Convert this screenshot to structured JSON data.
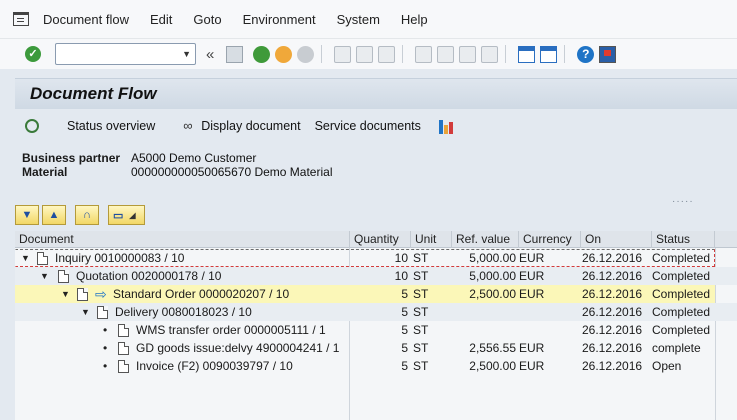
{
  "menu": {
    "items": [
      "Document flow",
      "Edit",
      "Goto",
      "Environment",
      "System",
      "Help"
    ]
  },
  "system_toolbar": {
    "command_field_value": "",
    "icons": [
      "enter-icon",
      "save-icon",
      "back-icon",
      "exit-icon",
      "cancel-icon",
      "print-icon",
      "find-icon",
      "find-next-icon",
      "first-page-icon",
      "previous-page-icon",
      "next-page-icon",
      "last-page-icon",
      "create-session-icon",
      "shortcut-icon",
      "help-icon",
      "customize-layout-icon"
    ],
    "help_glyph": "?"
  },
  "title": "Document Flow",
  "app_toolbar": {
    "status_overview": "Status overview",
    "display_document": "Display document",
    "service_documents": "Service documents"
  },
  "header_info": {
    "business_partner_label": "Business partner",
    "business_partner_value": "A5000 Demo Customer",
    "material_label": "Material",
    "material_value": "000000000050065670 Demo Material"
  },
  "grid_toolbar": {
    "icons": [
      "expand-all-icon",
      "collapse-all-icon",
      "find-icon",
      "print-icon"
    ]
  },
  "table": {
    "columns": [
      "Document",
      "Quantity",
      "Unit",
      "Ref. value",
      "Currency",
      "On",
      "Status"
    ],
    "rows": [
      {
        "document": "Inquiry 0010000083 / 10",
        "quantity": "10",
        "unit": "ST",
        "ref_value": "5,000.00",
        "currency": "EUR",
        "on": "26.12.2016",
        "status": "Completed"
      },
      {
        "document": "Quotation 0020000178 / 10",
        "quantity": "10",
        "unit": "ST",
        "ref_value": "5,000.00",
        "currency": "EUR",
        "on": "26.12.2016",
        "status": "Completed"
      },
      {
        "document": "Standard Order 0000020207 / 10",
        "quantity": "5",
        "unit": "ST",
        "ref_value": "2,500.00",
        "currency": "EUR",
        "on": "26.12.2016",
        "status": "Completed"
      },
      {
        "document": "Delivery 0080018023 / 10",
        "quantity": "5",
        "unit": "ST",
        "ref_value": "",
        "currency": "",
        "on": "26.12.2016",
        "status": "Completed"
      },
      {
        "document": "WMS transfer order 0000005111 / 1",
        "quantity": "5",
        "unit": "ST",
        "ref_value": "",
        "currency": "",
        "on": "26.12.2016",
        "status": "Completed"
      },
      {
        "document": "GD goods issue:delvy 4900004241 / 1",
        "quantity": "5",
        "unit": "ST",
        "ref_value": "2,556.55",
        "currency": "EUR",
        "on": "26.12.2016",
        "status": "complete"
      },
      {
        "document": "Invoice (F2) 0090039797 / 10",
        "quantity": "5",
        "unit": "ST",
        "ref_value": "2,500.00",
        "currency": "EUR",
        "on": "26.12.2016",
        "status": "Open"
      }
    ]
  },
  "colors": {
    "highlight_row": "#fbf7b8",
    "header_bg": "#dfe4ea",
    "accent_blue": "#1f74c6"
  }
}
